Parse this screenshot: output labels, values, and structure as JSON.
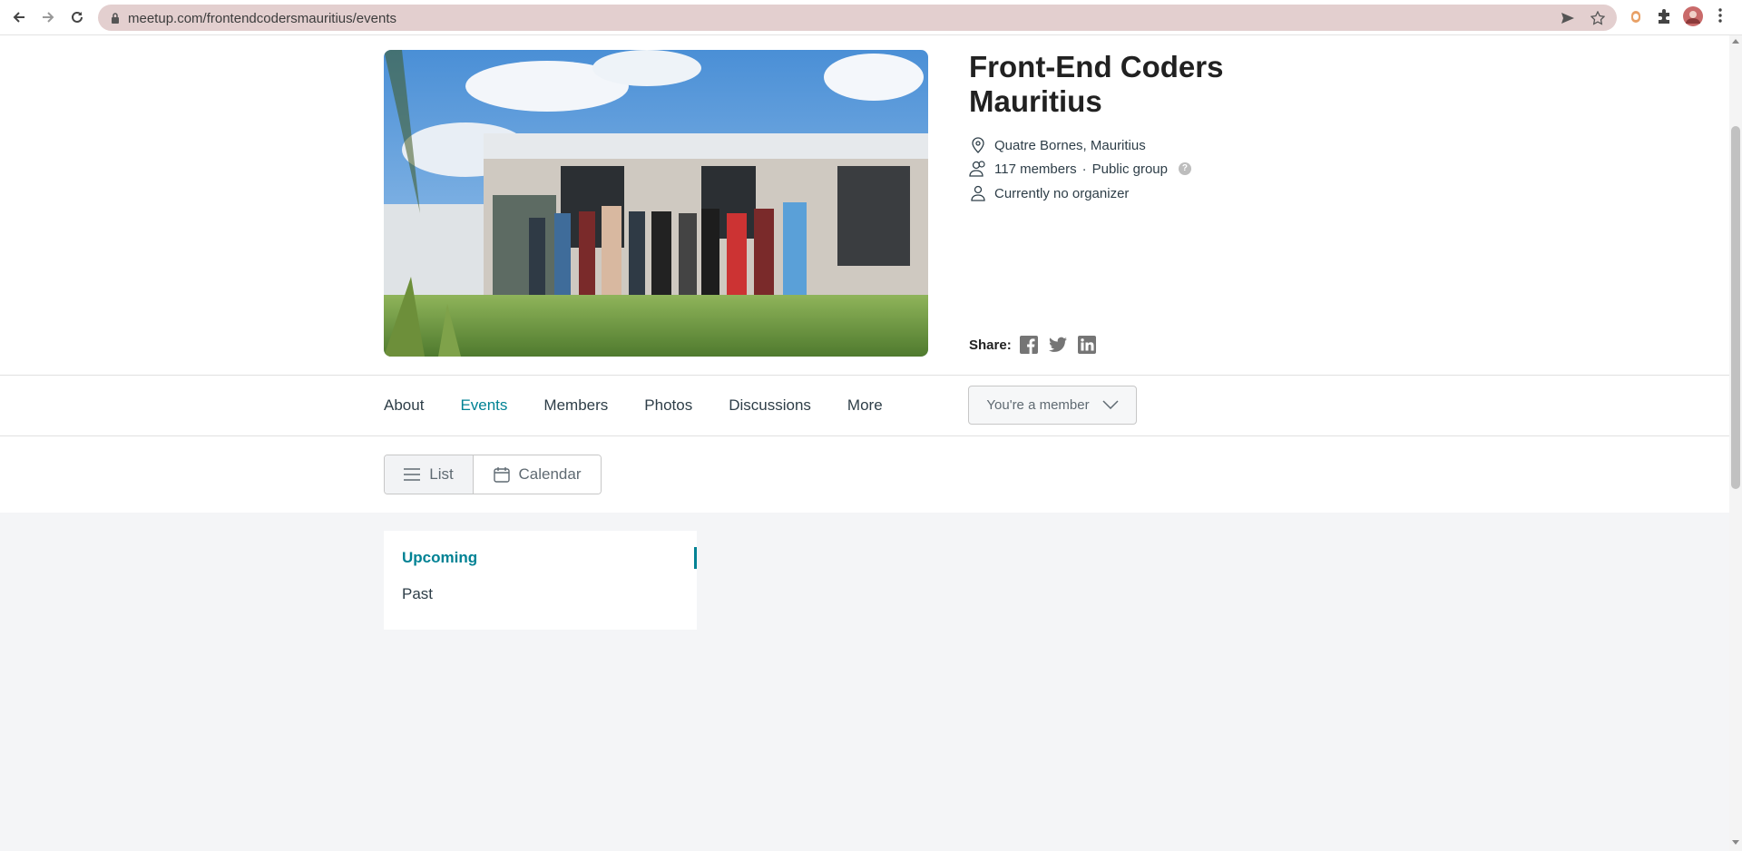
{
  "browser": {
    "url_host": "meetup.com",
    "url_path": "/frontendcodersmauritius/events"
  },
  "group": {
    "title": "Front-End Coders Mauritius",
    "location": "Quatre Bornes, Mauritius",
    "members": "117 members",
    "visibility": "Public group",
    "help_glyph": "?",
    "organizer": "Currently no organizer"
  },
  "share": {
    "label": "Share:",
    "icons": [
      "facebook-icon",
      "twitter-icon",
      "linkedin-icon"
    ]
  },
  "tabs": [
    {
      "label": "About"
    },
    {
      "label": "Events"
    },
    {
      "label": "Members"
    },
    {
      "label": "Photos"
    },
    {
      "label": "Discussions"
    },
    {
      "label": "More"
    }
  ],
  "active_tab": "Events",
  "member_button": {
    "label": "You're a member"
  },
  "view_toggle": {
    "list_label": "List",
    "calendar_label": "Calendar",
    "selected": "List"
  },
  "filters": {
    "upcoming": "Upcoming",
    "past": "Past",
    "selected": "Upcoming"
  },
  "colors": {
    "accent": "#008294",
    "omnibox": "#e3cfcf",
    "page_grey": "#f4f5f7"
  }
}
